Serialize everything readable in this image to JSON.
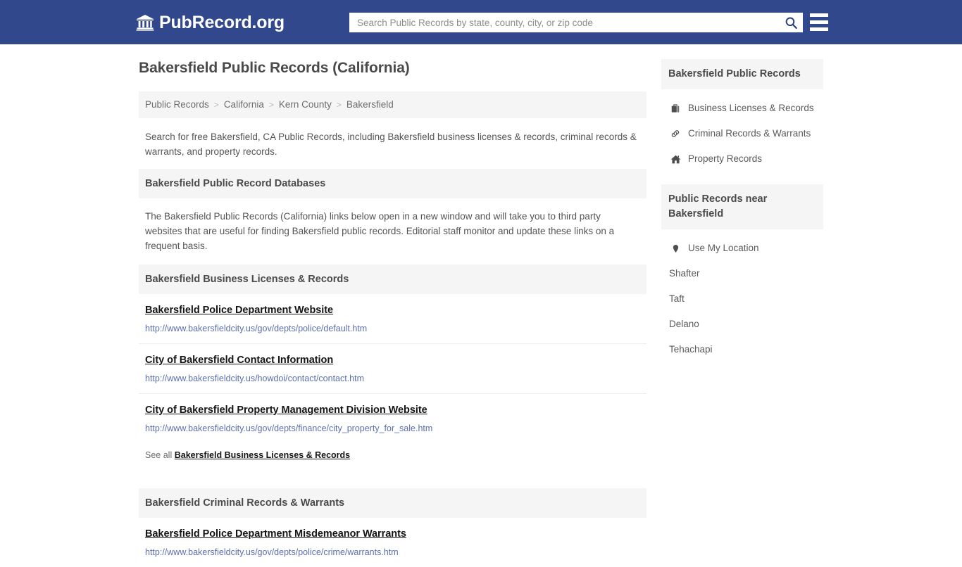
{
  "header": {
    "brand_icon": "bank-icon",
    "brand_text": "PubRecord.org",
    "search_placeholder": "Search Public Records by state, county, city, or zip code",
    "search_value": "",
    "search_icon": "search-icon",
    "menu_icon": "hamburger-menu-icon",
    "brand_bg_color": "#32488d"
  },
  "main": {
    "page_title": "Bakersfield Public Records (California)",
    "breadcrumb": {
      "items": [
        "Public Records",
        "California",
        "Kern County",
        "Bakersfield"
      ],
      "separator": ">"
    },
    "intro": "Search for free Bakersfield, CA Public Records, including Bakersfield business licenses & records, criminal records & warrants, and property records.",
    "databases": {
      "heading": "Bakersfield Public Record Databases",
      "paragraph": "The Bakersfield Public Records (California) links below open in a new window and will take you to third party websites that are useful for finding Bakersfield public records. Editorial staff monitor and update these links on a frequent basis."
    },
    "business_section": {
      "heading": "Bakersfield Business Licenses & Records",
      "links": [
        {
          "title": "Bakersfield Police Department Website",
          "url": "http://www.bakersfieldcity.us/gov/depts/police/default.htm"
        },
        {
          "title": "City of Bakersfield Contact Information",
          "url": "http://www.bakersfieldcity.us/howdoi/contact/contact.htm"
        },
        {
          "title": "City of Bakersfield Property Management Division Website",
          "url": "http://www.bakersfieldcity.us/gov/depts/finance/city_property_for_sale.htm"
        }
      ],
      "see_all_prefix": "See all",
      "see_all_link": "Bakersfield Business Licenses & Records"
    },
    "criminal_section": {
      "heading": "Bakersfield Criminal Records & Warrants",
      "links": [
        {
          "title": "Bakersfield Police Department Misdemeanor Warrants",
          "url": "http://www.bakersfieldcity.us/gov/depts/police/crime/warrants.htm"
        }
      ]
    }
  },
  "sidebar": {
    "records_card": {
      "heading": "Bakersfield Public Records",
      "items": [
        {
          "label": "Business Licenses & Records",
          "icon": "briefcase-icon"
        },
        {
          "label": "Criminal Records & Warrants",
          "icon": "link-chain-icon"
        },
        {
          "label": "Property Records",
          "icon": "home-icon"
        }
      ]
    },
    "nearby_card": {
      "heading": "Public Records near Bakersfield",
      "use_location": {
        "label": "Use My Location",
        "icon": "map-pin-icon"
      },
      "cities": [
        "Shafter",
        "Taft",
        "Delano",
        "Tehachapi"
      ]
    }
  }
}
